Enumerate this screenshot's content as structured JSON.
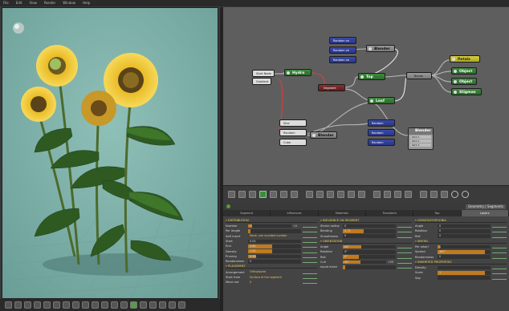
{
  "menubar": [
    "File",
    "Edit",
    "View",
    "Render",
    "Window",
    "Help"
  ],
  "graph": {
    "nodes": {
      "start_node": "Start Node",
      "hydra": "Hydra",
      "blender1": "Blender",
      "top": "Top",
      "leaf": "Leaf",
      "petals": "Petals",
      "object1": "Object",
      "object2": "Object",
      "stigmas": "Stigmas",
      "blender2": "Blender",
      "blender3": "Blender",
      "segment": "Segment",
      "random_a": "Random va",
      "random_b": "Random va",
      "random_c": "Random va",
      "random_d": "Random",
      "random_e": "Random",
      "random_f": "Random",
      "gradient": "Gradient",
      "random_g": "Random",
      "bends": "Bends",
      "sine": "Sine",
      "cube": "Cube"
    },
    "blender_panel_rows": [
      "Path 1",
      "Path 2",
      "Path 3"
    ]
  },
  "sheet": {
    "title": "Geometry | Segments",
    "tabs": [
      "Segment",
      "Influences",
      "Materials",
      "Transform",
      "Top",
      "Layers"
    ],
    "active_tab": 5,
    "col1": {
      "distribution": "DISTRIBUTION",
      "rows": [
        {
          "label": "Number",
          "value": "7",
          "extra": "+2",
          "fill": 0.1
        },
        {
          "label": "Per length",
          "value": "",
          "fill": 0.04
        },
        {
          "label": "Soft insert",
          "value": "None, use rounded number",
          "text": true
        },
        {
          "label": "Start",
          "value": "0.00",
          "fill": 0.0
        },
        {
          "label": "End",
          "value": "0.80",
          "fill": 0.45
        },
        {
          "label": "Density",
          "value": "1.00",
          "fill": 0.45
        },
        {
          "label": "Pruning",
          "value": "0.28",
          "fill": 0.15
        },
        {
          "label": "Randomness",
          "value": "0",
          "fill": 0.0
        }
      ],
      "placement": "PLACEMENT",
      "placement_rows": [
        {
          "label": "Arrangement",
          "value": "Ortho/spiral"
        },
        {
          "label": "Start from",
          "value": "Surface of the segment"
        },
        {
          "label": "Move out",
          "value": "0"
        }
      ]
    },
    "col2": {
      "influence": "INFLUENCE ON SEGMENT",
      "rows": [
        {
          "label": "Shrink radius",
          "value": "0",
          "fill": 0.0
        },
        {
          "label": "Bending",
          "value": "0.75",
          "fill": 0.4
        },
        {
          "label": "Smoothness",
          "value": "0",
          "fill": 0.0
        }
      ],
      "orientation": "ORIENTATION",
      "orient_rows": [
        {
          "label": "Angle",
          "value": "64°",
          "fill": 0.35
        },
        {
          "label": "Rotation",
          "value": "0°",
          "fill": 0.0
        },
        {
          "label": "Roll",
          "value": "0°",
          "fill": 0.3
        },
        {
          "label": "Curl",
          "value": "90°",
          "extra": "+25",
          "fill": 0.4
        },
        {
          "label": "Avoid mesh",
          "value": "",
          "fill": 0.05
        }
      ]
    },
    "col3": {
      "horizon": "HORIZONTOPHOBIA",
      "rows": [
        {
          "label": "Angle",
          "value": "0",
          "fill": 0.0
        },
        {
          "label": "Rotation",
          "value": "0",
          "fill": 0.0
        },
        {
          "label": "Roll",
          "value": "0",
          "fill": 0.0
        }
      ],
      "whorl": "WHORL",
      "whorl_rows": [
        {
          "label": "Per whorl",
          "value": "1",
          "fill": 0.05
        },
        {
          "label": "Spread",
          "value": "360°",
          "fill": 0.9
        },
        {
          "label": "Randomness",
          "value": "0",
          "fill": 0.0
        }
      ],
      "inherited": "INHERITED PROPERTIES",
      "inherited_rows": [
        {
          "label": "Density",
          "value": "",
          "fill": 0.0
        },
        {
          "label": "Scale",
          "value": "1",
          "fill": 0.9
        },
        {
          "label": "Sap",
          "value": "",
          "fill": 0.0
        }
      ]
    }
  },
  "colors": {
    "viewport_bg": "#7fb0a9",
    "graph_bg": "#5e5e5e",
    "accent_orange": "#c07a20",
    "node_green": "#3f8a3f",
    "node_yellow": "#d8d040"
  }
}
